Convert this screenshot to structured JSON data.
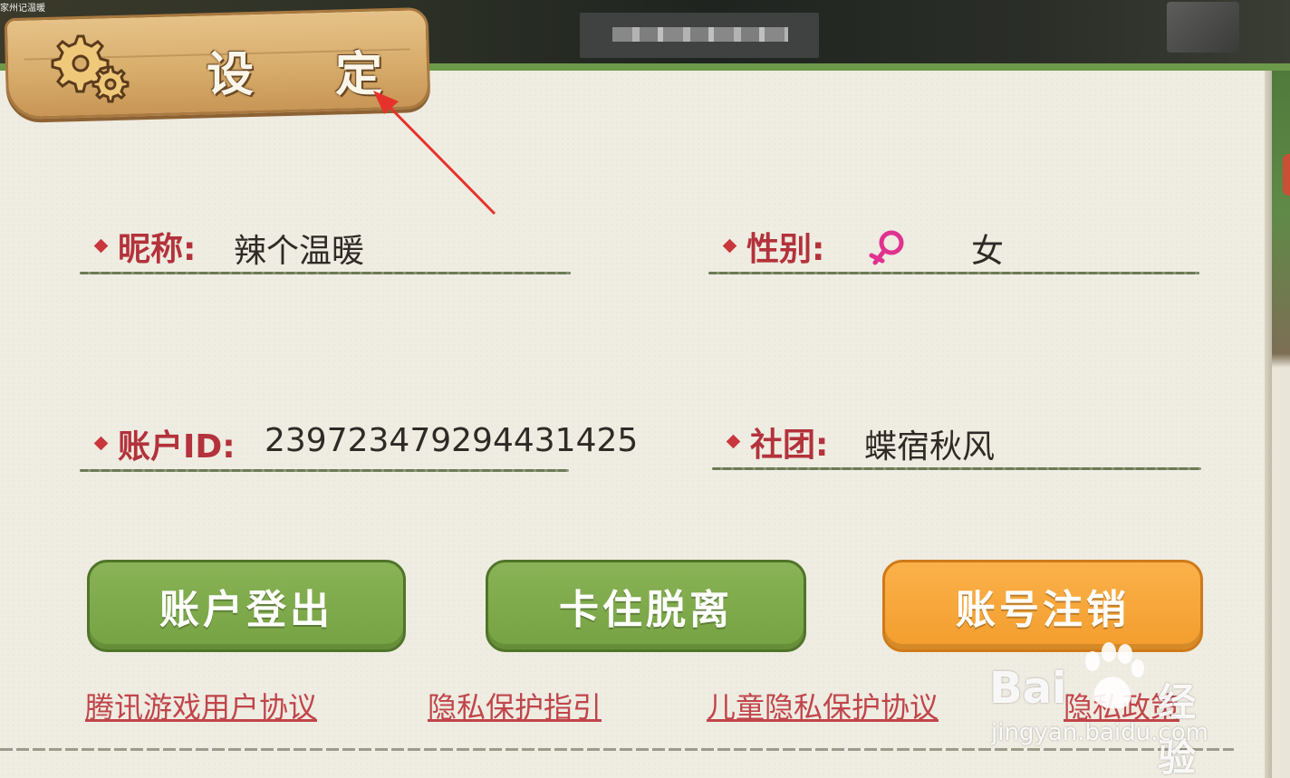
{
  "header": {
    "corner_text": "家州记温暖",
    "title": "设 定"
  },
  "profile": {
    "nickname": {
      "label": "昵称:",
      "value": "辣个温暖"
    },
    "gender": {
      "label": "性别:",
      "value": "女",
      "icon": "female-icon"
    },
    "account_id": {
      "label": "账户ID:",
      "value": "239723479294431425"
    },
    "club": {
      "label": "社团:",
      "value": "蝶宿秋风"
    }
  },
  "buttons": {
    "logout": "账户登出",
    "unstuck": "卡住脱离",
    "delete_account": "账号注销"
  },
  "links": {
    "user_agreement": "腾讯游戏用户协议",
    "privacy_guide": "隐私保护指引",
    "child_privacy": "儿童隐私保护协议",
    "partial": "隐私政策"
  },
  "watermark": {
    "brand": "Bai",
    "cn": "经验",
    "url": "jingyan.baidu.com"
  },
  "colors": {
    "label_red": "#b3323b",
    "button_green": "#7eaa4b",
    "button_orange": "#f6a43a",
    "link_red": "#c0454a",
    "panel_bg": "#efece2",
    "title_board": "#d8ad6c"
  }
}
